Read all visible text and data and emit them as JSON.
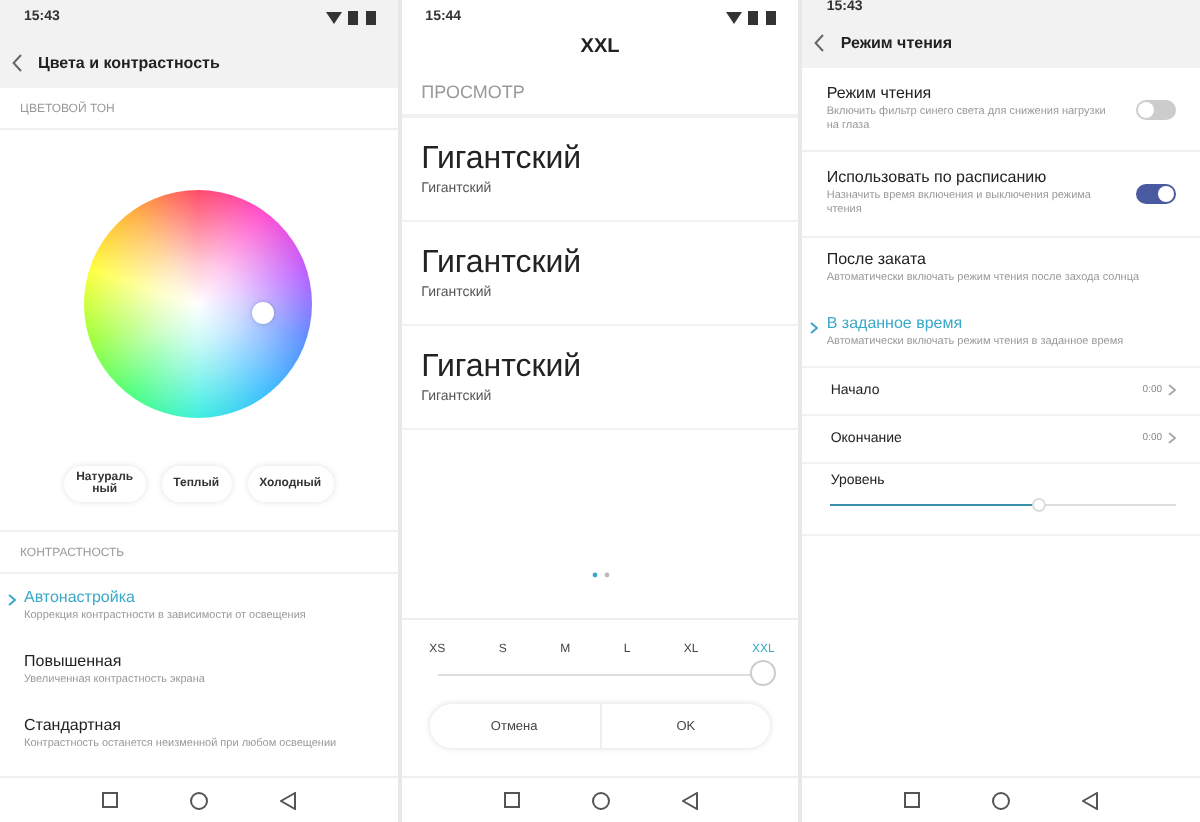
{
  "color_screen": {
    "time": "15:43",
    "title": "Цвета и контрастность",
    "tone_section": "ЦВЕТОВОЙ ТОН",
    "presets": [
      {
        "label": "Натураль\nный"
      },
      {
        "label": "Теплый"
      },
      {
        "label": "Холодный"
      }
    ],
    "contrast_section": "КОНТРАСТНОСТЬ",
    "options": [
      {
        "title": "Автонастройка",
        "subtitle": "Коррекция контрастности в зависимости от освещения",
        "selected": true
      },
      {
        "title": "Повышенная",
        "subtitle": "Увеличенная контрастность экрана",
        "selected": false
      },
      {
        "title": "Стандартная",
        "subtitle": "Контрастность останется неизменной при любом освещении",
        "selected": false
      }
    ]
  },
  "font_screen": {
    "time": "15:44",
    "title": "XXL",
    "preview_section": "ПРОСМОТР",
    "previews": [
      {
        "large": "Гигантский",
        "small": "Гигантский"
      },
      {
        "large": "Гигантский",
        "small": "Гигантский"
      },
      {
        "large": "Гигантский",
        "small": "Гигантский"
      }
    ],
    "sizes": [
      {
        "label": "XS",
        "selected": false
      },
      {
        "label": "S",
        "selected": false
      },
      {
        "label": "M",
        "selected": false
      },
      {
        "label": "L",
        "selected": false
      },
      {
        "label": "XL",
        "selected": false
      },
      {
        "label": "XXL",
        "selected": true
      }
    ],
    "buttons": [
      "Отмена",
      "OK"
    ]
  },
  "reading_screen": {
    "time": "15:43",
    "title": "Режим чтения",
    "rows": [
      {
        "kind": "toggle",
        "title": "Режим чтения",
        "subtitle": "Включить фильтр синего света для снижения нагрузки на глаза",
        "on": false
      },
      {
        "kind": "toggle",
        "title": "Использовать по расписанию",
        "subtitle": "Назначить время включения и выключения режима чтения",
        "on": true
      },
      {
        "kind": "radio",
        "title": "После заката",
        "subtitle": "Автоматически включать режим чтения после захода солнца",
        "selected": false
      },
      {
        "kind": "radio",
        "title": "В заданное время",
        "subtitle": "Автоматически включать режим чтения в заданное время",
        "selected": true
      },
      {
        "kind": "time",
        "title": "Начало",
        "value": "0:00"
      },
      {
        "kind": "time",
        "title": "Окончание",
        "value": "0:00"
      },
      {
        "kind": "slider",
        "title": "Уровень",
        "level": 0.6
      }
    ]
  }
}
